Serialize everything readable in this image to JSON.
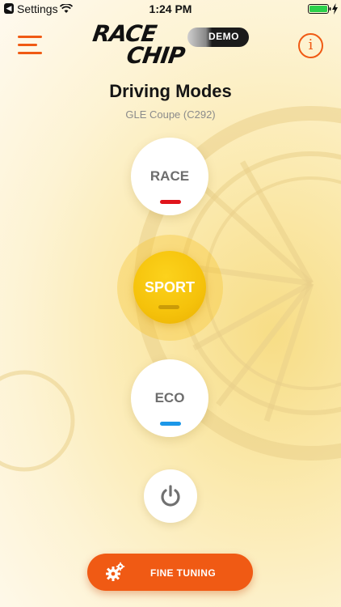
{
  "status_bar": {
    "back_app": "Settings",
    "time": "1:24 PM"
  },
  "header": {
    "logo_line1": "RACE",
    "logo_line2": "CHIP",
    "demo_label": "DEMO",
    "info_glyph": "i"
  },
  "page": {
    "title": "Driving Modes",
    "vehicle": "GLE Coupe (C292)"
  },
  "modes": {
    "race": {
      "label": "RACE",
      "indicator_color": "#e0141c"
    },
    "sport": {
      "label": "SPORT",
      "indicator_color": "#b88a06",
      "selected": true
    },
    "eco": {
      "label": "ECO",
      "indicator_color": "#1c97e8"
    }
  },
  "power": {
    "icon": "power-icon"
  },
  "fine_tuning": {
    "label": "FINE TUNING",
    "icon": "gear-icon"
  },
  "colors": {
    "accent": "#f05a14",
    "sport_yellow": "#f5c20b"
  }
}
